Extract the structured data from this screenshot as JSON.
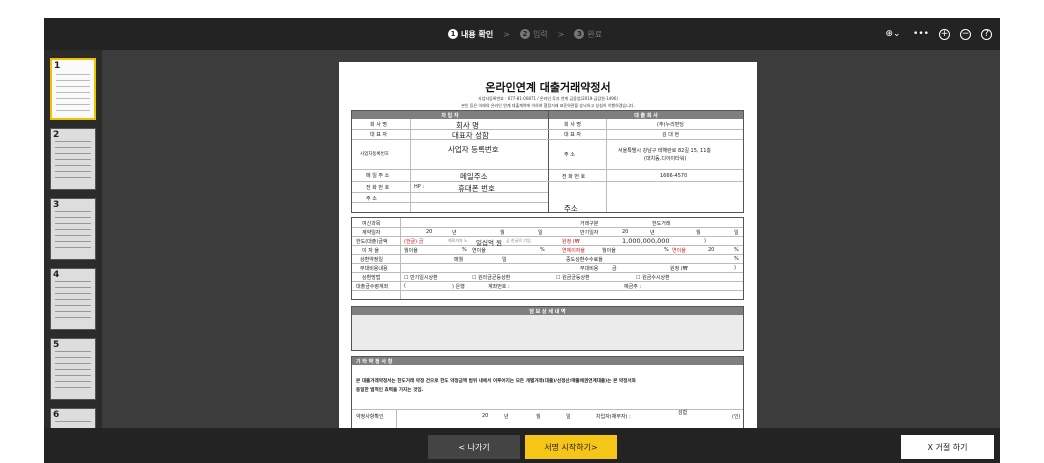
{
  "steps": [
    {
      "num": "1",
      "label": "내용 확인",
      "active": true
    },
    {
      "num": "2",
      "label": "입력",
      "active": false
    },
    {
      "num": "3",
      "label": "완료",
      "active": false
    }
  ],
  "step_separator": ">",
  "toolbar": {
    "language_icon": "⊕⌄",
    "more_icon": "•••",
    "zoom_in_icon": "+",
    "zoom_out_icon": "−",
    "help_icon": "?"
  },
  "thumbnails": [
    "1",
    "2",
    "3",
    "4",
    "5",
    "6"
  ],
  "document": {
    "title": "온라인연계 대출거래약정서",
    "subtitle_1": "사업자등록번호 : 677-81-00871 / 온라인 투자 연계 금융업(2019-금감원-1496)",
    "subtitle_2": "본인 등은 아래의 온라인 연계 대출계약에 이하여 협정거래 표준약관을 승낙하고 성실히 이행하겠습니다.",
    "parties": {
      "borrower_header": "차 입 자",
      "lender_header": "대 출 회 사",
      "company_label": "회 사 명",
      "company_value": "회사 명",
      "ceo_label": "대 표 자",
      "ceo_value": "대표자 성함",
      "bizno_label": "사업자등록번호",
      "bizno_value": "사업자 등록번호",
      "email_label": "메 일 주 소",
      "email_value": "메일주소",
      "phone_label": "전 화 번 호",
      "phone_prefix": "HP :",
      "phone_value": "휴대폰 번호",
      "address_label": "주 소",
      "address_value": "주소",
      "lender_company_label": "회 사 명",
      "lender_company_value": "(주)누리펀딩",
      "lender_ceo_label": "대 표 자",
      "lender_ceo_value": "김 대 현",
      "lender_address_label": "주 소",
      "lender_address_value": "서울특별시 강남구 테헤란로 82길 15, 11층",
      "lender_address_value_2": "(대치동,디아이타워)",
      "lender_phone_label": "전 화 번 호",
      "lender_phone_value": "1666-4570"
    },
    "loan": {
      "product_label": "여신과목",
      "trade_type_label": "거래구분",
      "trade_type_value": "한도거래",
      "contract_date_label": "계약일자",
      "contract_year": "20",
      "year_unit": "년",
      "month_unit": "월",
      "day_unit": "일",
      "expiry_label": "만기일자",
      "expiry_year": "20",
      "limit_label": "한도(대출)금액",
      "limit_krw": "(한글) 금",
      "limit_hint": "해외자자 노",
      "limit_value": "일십억 원",
      "limit_hint_2": "금 한글로 기입",
      "limit_num_prefix": "원정 (₩",
      "limit_num_value": "1,000,000,000",
      "limit_num_suffix": ")",
      "interest_label": "이 자 율",
      "interest_monthly": "월이율",
      "pct": "%",
      "interest_yearly": "연이율",
      "overdue_label": "연체이자율",
      "overdue_monthly": "월이율",
      "overdue_yearly": "연이율",
      "overdue_yearly_value": "20",
      "repay_day_label": "상환약정일",
      "repay_day_mid": "매월",
      "early_fee_label": "중도상환수수료율",
      "extra_cost_label": "부대비용내용",
      "extra_cost_label_2": "부대비용",
      "extra_cost_mid": "금",
      "extra_cost_won": "원정 (₩",
      "extra_cost_close": ")",
      "repay_method_label": "상환방법",
      "repay_options": [
        "☐ 만기일시상환",
        "☐ 원리금균등상환",
        "☐ 원금균등상환",
        "☐ 원금수시상환"
      ],
      "account_label": "대출금수령계좌",
      "account_open": "(",
      "account_bank": ") 은행",
      "account_number": "계좌번호 :",
      "account_holder": "예금주 :"
    },
    "collateral_header": "담 보 상 세 내 역",
    "terms_header": "기 타 약 정 사 항",
    "terms_text_1": "본 대출거래약정서는 한도거래 약정 건으로 한도 약정금액 범위 내에서 이루어지는 모든 개별거래(대출)/선정산/매출채권연계대출)는 본 약정서와",
    "terms_text_2": "동일한 법적인 효력을 가지는 것임.",
    "confirm_label": "약정사항확인",
    "confirm_year": "20",
    "confirm_signer": "차입자(채무자) :",
    "confirm_seal": "(인)",
    "confirm_name": "성함"
  },
  "buttons": {
    "back": "< 나가기",
    "sign": "서명 시작하기>",
    "reject": "X 거절 하기"
  }
}
